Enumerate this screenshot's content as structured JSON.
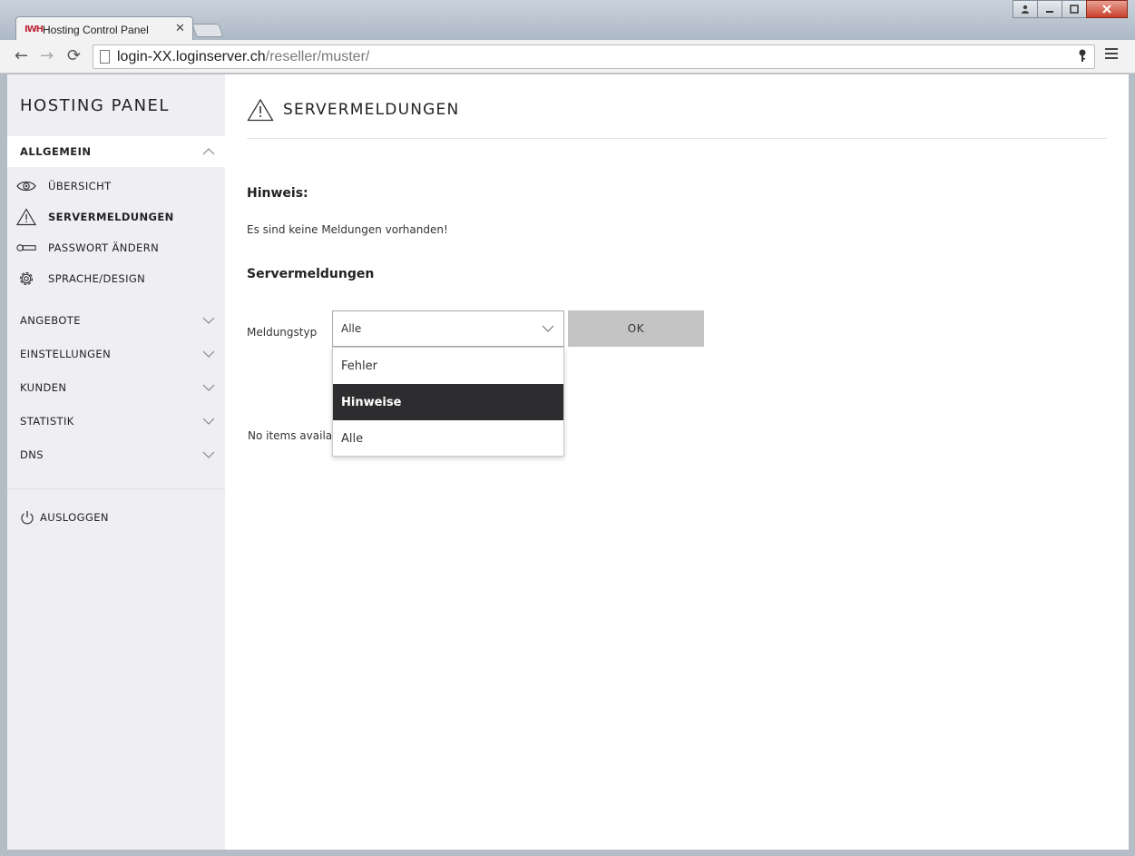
{
  "browser": {
    "tab_title": "Hosting Control Panel",
    "favicon_text": "IWH",
    "tab_close": "✕",
    "url_host": "login-XX.loginserver.ch",
    "url_path": "/reseller/muster/",
    "back": "←",
    "forward": "→",
    "reload": "⟳"
  },
  "sidebar": {
    "brand": "HOSTING PANEL",
    "section": "ALLGEMEIN",
    "items": [
      {
        "label": "ÜBERSICHT",
        "icon": "eye-icon"
      },
      {
        "label": "SERVERMELDUNGEN",
        "icon": "warning-icon",
        "active": true
      },
      {
        "label": "PASSWORT ÄNDERN",
        "icon": "key-icon"
      },
      {
        "label": "SPRACHE/DESIGN",
        "icon": "gear-icon"
      }
    ],
    "groups": [
      "ANGEBOTE",
      "EINSTELLUNGEN",
      "KUNDEN",
      "STATISTIK",
      "DNS"
    ],
    "logout": "AUSLOGGEN"
  },
  "main": {
    "title": "SERVERMELDUNGEN",
    "hinweis_heading": "Hinweis:",
    "hinweis_text": "Es sind keine Meldungen vorhanden!",
    "section_heading": "Servermeldungen",
    "filter_label": "Meldungstyp",
    "select_value": "Alle",
    "ok_label": "OK",
    "empty_text": "No items availal",
    "options": [
      "Fehler",
      "Hinweise",
      "Alle"
    ],
    "highlighted_option": "Hinweise"
  },
  "colors": {
    "sidebar_bg": "#efeff3",
    "highlight": "#2d2d2f",
    "button": "#c4c4c4"
  }
}
